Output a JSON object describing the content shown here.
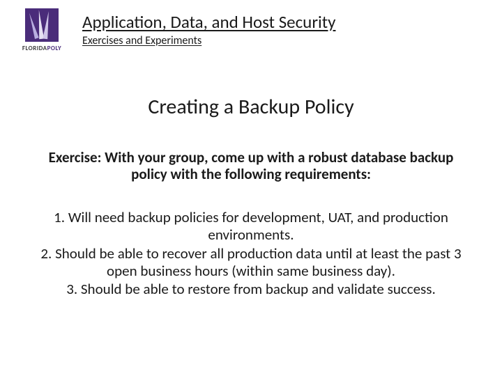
{
  "logo": {
    "brand_a": "FLORIDA",
    "brand_b": "POLY"
  },
  "header": {
    "course_title": "Application, Data, and Host Security",
    "subtitle": "Exercises and Experiments"
  },
  "slide": {
    "title": "Creating a Backup Policy",
    "prompt": "Exercise: With your group, come up with a robust database backup policy with the following requirements:",
    "items": [
      "Will need backup policies for development, UAT, and production environments.",
      "Should be able to recover all production data until at least the past 3 open business hours (within same business day).",
      "Should be able to restore from backup and validate success."
    ]
  }
}
